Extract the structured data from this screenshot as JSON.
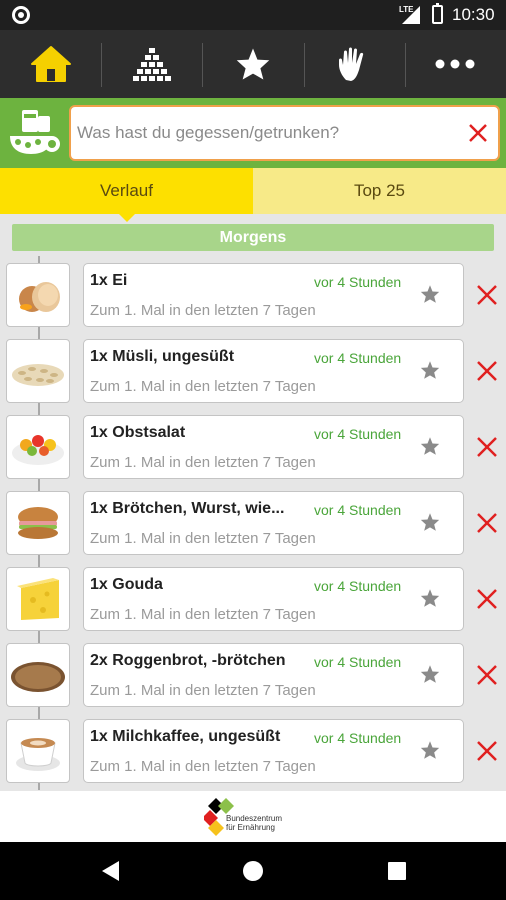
{
  "status_bar": {
    "time": "10:30",
    "network": "LTE",
    "icons": [
      "notification-dot-icon",
      "signal-icon",
      "battery-icon"
    ]
  },
  "nav": {
    "items": [
      {
        "name": "home",
        "icon": "home-icon",
        "active_color": "#f5d000"
      },
      {
        "name": "pyramid",
        "icon": "pyramid-icon"
      },
      {
        "name": "favorites",
        "icon": "star-icon"
      },
      {
        "name": "hand",
        "icon": "hand-icon"
      },
      {
        "name": "more",
        "icon": "more-icon"
      }
    ]
  },
  "search": {
    "placeholder": "Was hast du gegessen/getrunken?",
    "value": "",
    "clear_icon": "close-icon"
  },
  "tabs": [
    {
      "label": "Verlauf",
      "active": true
    },
    {
      "label": "Top 25",
      "active": false
    }
  ],
  "section": {
    "title": "Morgens"
  },
  "entries": [
    {
      "name": "1x Ei",
      "time": "vor 4 Stunden",
      "sub": "Zum 1. Mal in den letzten 7 Tagen",
      "image": "egg-image"
    },
    {
      "name": "1x Müsli, ungesüßt",
      "time": "vor 4 Stunden",
      "sub": "Zum 1. Mal in den letzten 7 Tagen",
      "image": "muesli-image"
    },
    {
      "name": "1x Obstsalat",
      "time": "vor 4 Stunden",
      "sub": "Zum 1. Mal in den letzten 7 Tagen",
      "image": "fruit-salad-image"
    },
    {
      "name": "1x Brötchen, Wurst, wie...",
      "time": "vor 4 Stunden",
      "sub": "Zum 1. Mal in den letzten 7 Tagen",
      "image": "sandwich-image"
    },
    {
      "name": "1x Gouda",
      "time": "vor 4 Stunden",
      "sub": "Zum 1. Mal in den letzten 7 Tagen",
      "image": "cheese-image"
    },
    {
      "name": "2x Roggenbrot, -brötchen",
      "time": "vor 4 Stunden",
      "sub": "Zum 1. Mal in den letzten 7 Tagen",
      "image": "bread-image"
    },
    {
      "name": "1x Milchkaffee, ungesüßt",
      "time": "vor 4 Stunden",
      "sub": "Zum 1. Mal in den letzten 7 Tagen",
      "image": "coffee-image"
    }
  ],
  "footer": {
    "logo_line1": "Bundeszentrum",
    "logo_line2": "für Ernährung"
  },
  "colors": {
    "green": "#6db33f",
    "yellow": "#fde000",
    "time_green": "#4aa53a",
    "delete_red": "#e02020",
    "search_border": "#f0a04b"
  }
}
